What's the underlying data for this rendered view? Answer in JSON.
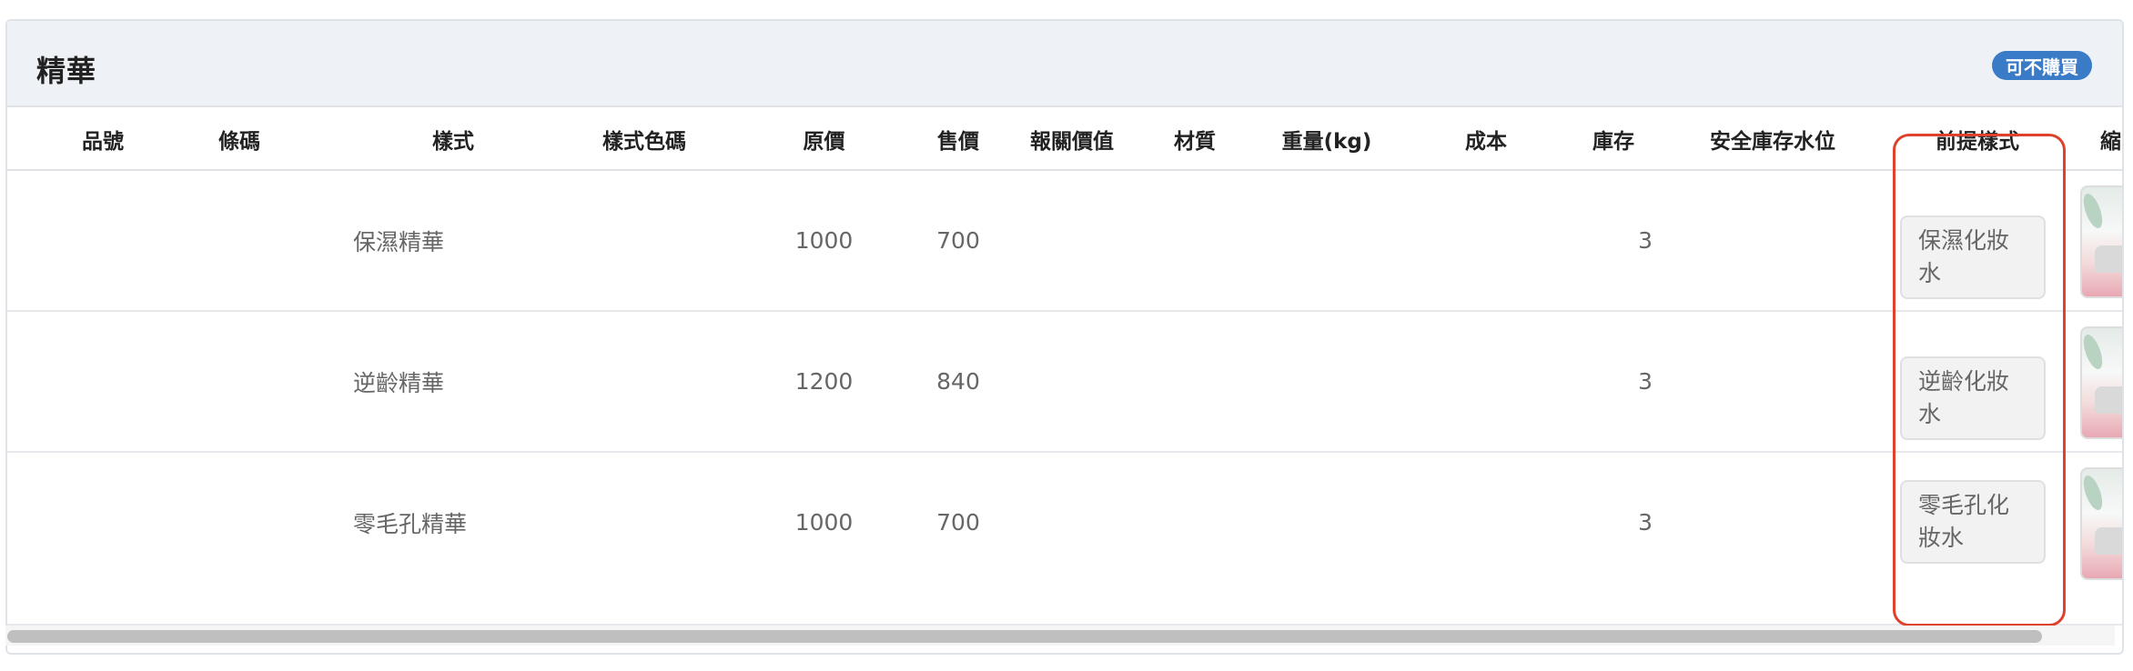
{
  "panel": {
    "title": "精華",
    "badge": {
      "label": "可不購買",
      "color": "#3a7bc8"
    }
  },
  "table": {
    "columns": [
      "品號",
      "條碼",
      "樣式",
      "樣式色碼",
      "原價",
      "售價",
      "報關價值",
      "材質",
      "重量(kg)",
      "成本",
      "庫存",
      "安全庫存水位",
      "前提樣式",
      "縮"
    ],
    "rows": [
      {
        "style": "保濕精華",
        "original_price": "1000",
        "sale_price": "700",
        "stock": "3",
        "prerequisite_style": "保濕化妝水"
      },
      {
        "style": "逆齡精華",
        "original_price": "1200",
        "sale_price": "840",
        "stock": "3",
        "prerequisite_style": "逆齡化妝水"
      },
      {
        "style": "零毛孔精華",
        "original_price": "1000",
        "sale_price": "700",
        "stock": "3",
        "prerequisite_style": "零毛孔化妝水"
      }
    ]
  },
  "colors": {
    "highlight": "#e0412c",
    "header_bg": "#eef1f5"
  },
  "icons": {
    "thumbnail": "product-thumbnail-icon"
  }
}
